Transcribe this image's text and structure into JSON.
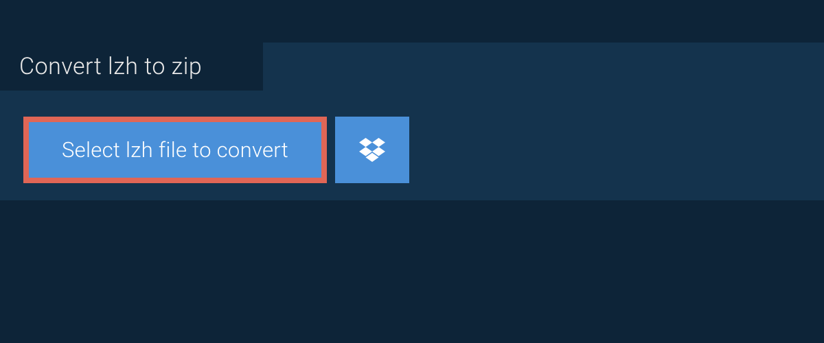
{
  "tab": {
    "title": "Convert lzh to zip"
  },
  "actions": {
    "select_label": "Select lzh file to convert"
  },
  "colors": {
    "page_bg": "#0d2438",
    "panel_bg": "#14334d",
    "button_bg": "#4a90d9",
    "highlight_border": "#e06656"
  }
}
